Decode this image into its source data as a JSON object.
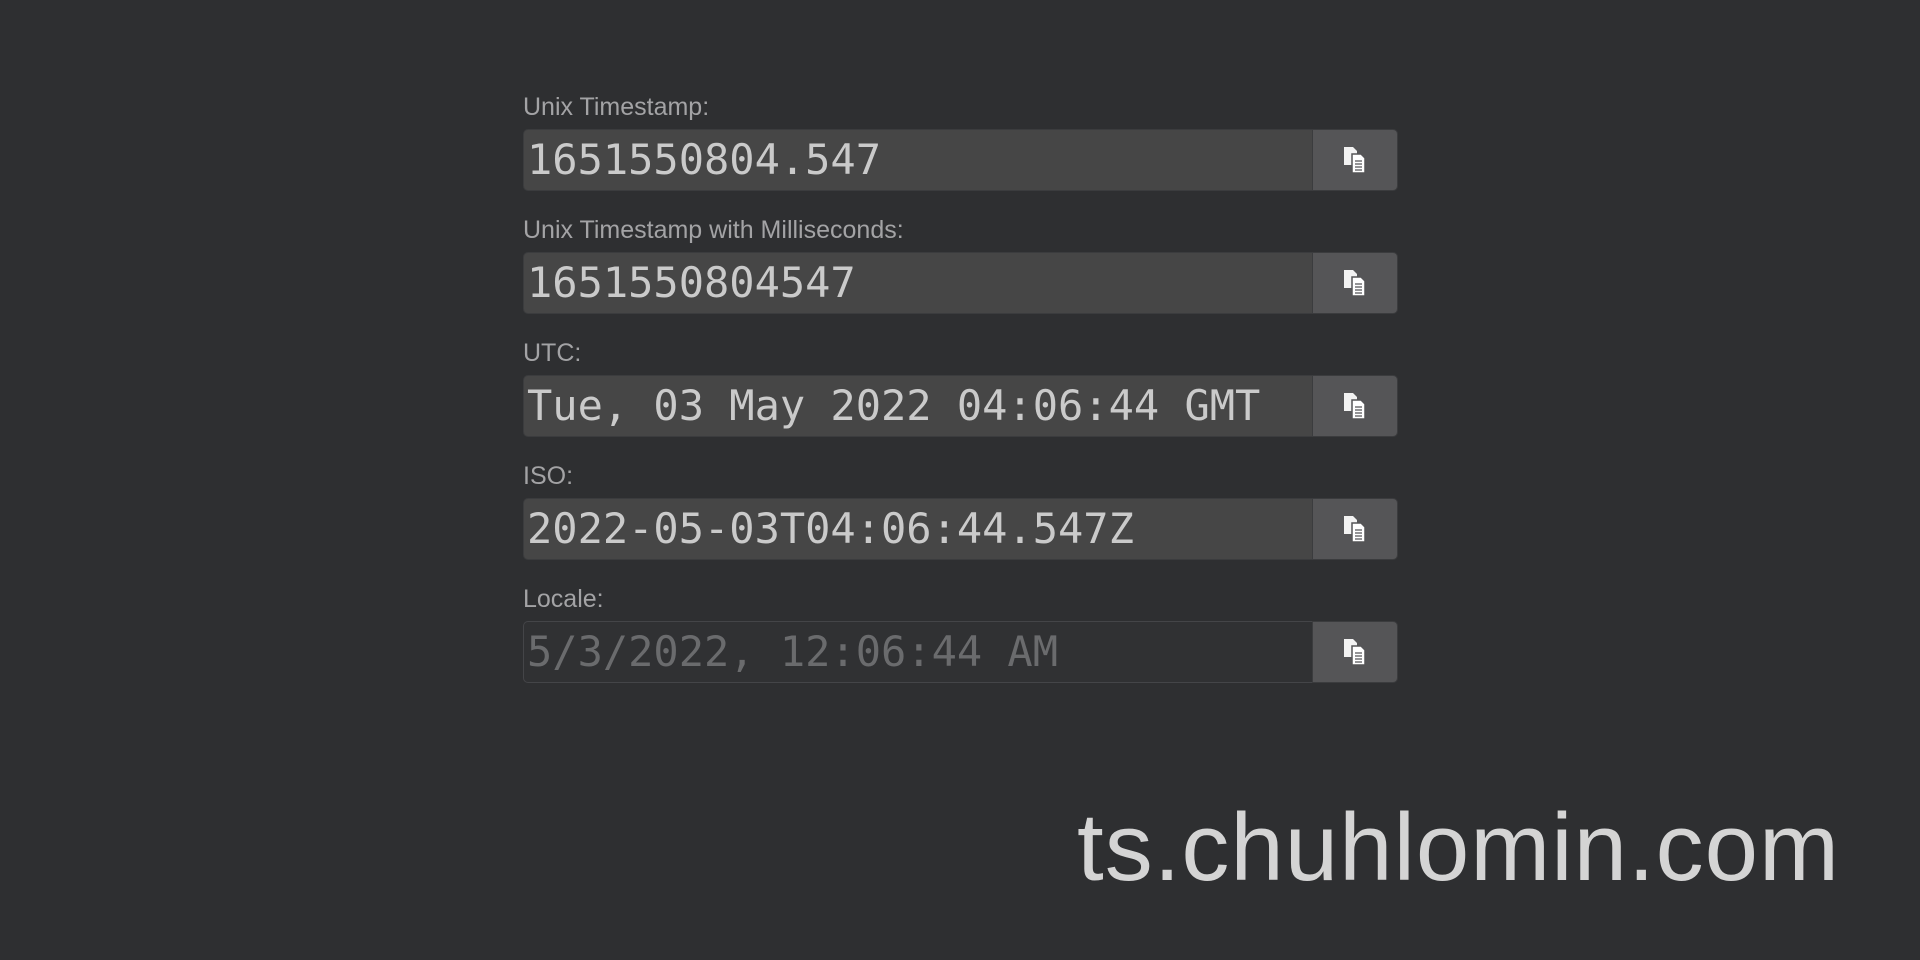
{
  "fields": [
    {
      "label": "Unix Timestamp:",
      "value": "1651550804.547",
      "copy_icon": "copy-icon"
    },
    {
      "label": "Unix Timestamp with Milliseconds:",
      "value": "1651550804547",
      "copy_icon": "copy-icon"
    },
    {
      "label": "UTC:",
      "value": "Tue, 03 May 2022 04:06:44 GMT",
      "copy_icon": "copy-icon"
    },
    {
      "label": "ISO:",
      "value": "2022-05-03T04:06:44.547Z",
      "copy_icon": "copy-icon"
    },
    {
      "label": "Locale:",
      "value": "5/3/2022, 12:06:44 AM",
      "copy_icon": "copy-icon"
    }
  ],
  "watermark": "ts.chuhlomin.com",
  "colors": {
    "background": "#2e2f31",
    "label": "#a3a3a5",
    "field_background": "#464646",
    "field_text": "#cacaca",
    "field_muted_text": "#6a6b6d",
    "button_background": "#555557",
    "watermark": "#d4d4d4"
  }
}
